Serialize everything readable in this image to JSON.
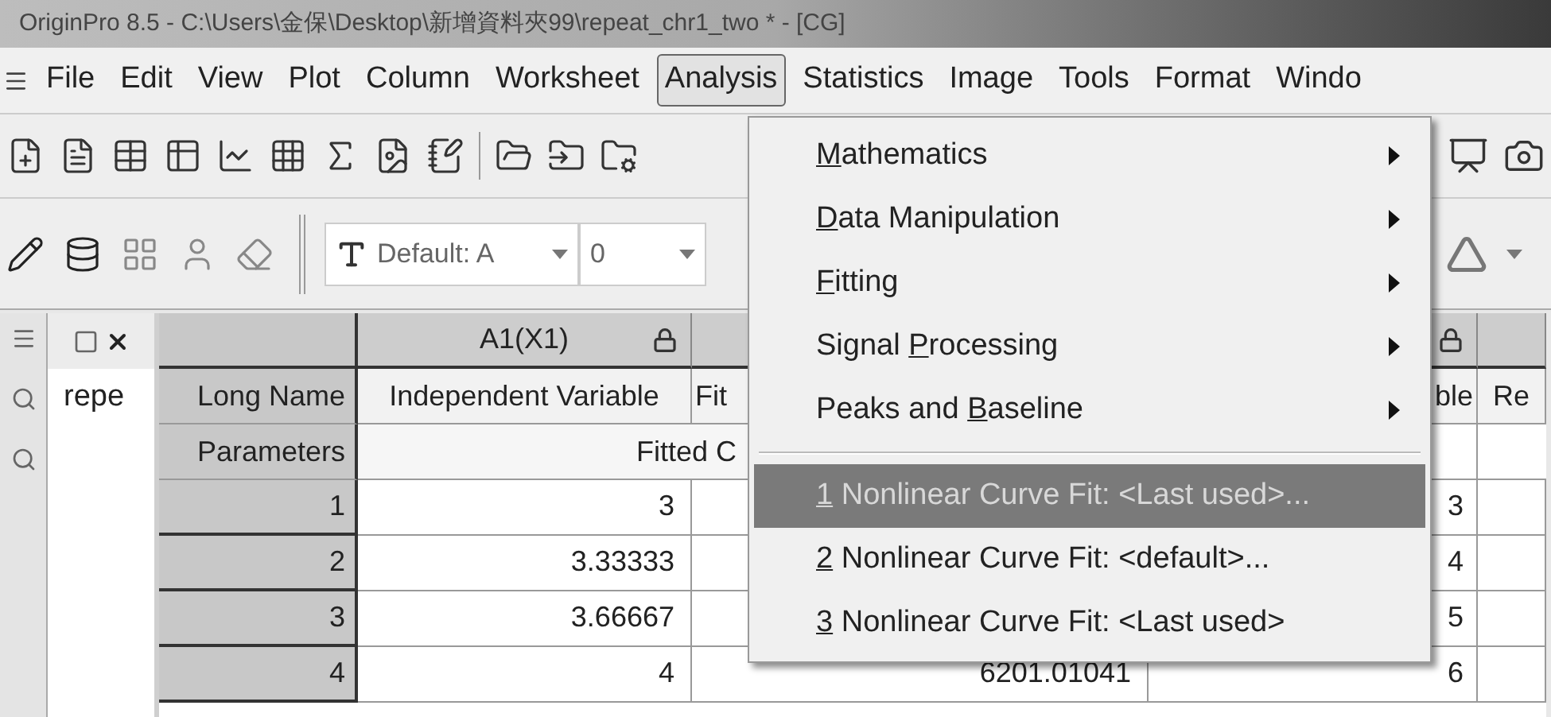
{
  "window": {
    "title": "OriginPro 8.5 - C:\\Users\\金保\\Desktop\\新增資料夾99\\repeat_chr1_two * - [CG]"
  },
  "menu_bar": [
    {
      "label": "File",
      "selected": false
    },
    {
      "label": "Edit",
      "selected": false
    },
    {
      "label": "View",
      "selected": false
    },
    {
      "label": "Plot",
      "selected": false
    },
    {
      "label": "Column",
      "selected": false
    },
    {
      "label": "Worksheet",
      "selected": false
    },
    {
      "label": "Analysis",
      "selected": true
    },
    {
      "label": "Statistics",
      "selected": false
    },
    {
      "label": "Image",
      "selected": false
    },
    {
      "label": "Tools",
      "selected": false
    },
    {
      "label": "Format",
      "selected": false
    },
    {
      "label": "Windo",
      "selected": false
    }
  ],
  "format_toolbar": {
    "font_dropdown": "Default: A",
    "size_dropdown": "0"
  },
  "project_panel": {
    "item": "repe"
  },
  "worksheet": {
    "row_labels": [
      "Long Name",
      "Parameters",
      "1",
      "2",
      "3",
      "4"
    ],
    "parameters_merged": "Fitted C",
    "columns": [
      {
        "header": "A1(X1)",
        "locked": true,
        "long_name": "Independent Variable",
        "values": [
          "3",
          "3.33333",
          "3.66667",
          "4"
        ]
      },
      {
        "long_name": "Fit",
        "last_value": "6201.01041"
      },
      {
        "locked": true,
        "long_name": "ble",
        "values": [
          "3",
          "4",
          "5",
          "6"
        ]
      },
      {
        "long_name": "Re"
      }
    ]
  },
  "analysis_menu": {
    "items": [
      {
        "kind": "submenu",
        "key": "M",
        "after": "athematics",
        "selected": false
      },
      {
        "kind": "submenu",
        "key": "D",
        "after": "ata Manipulation",
        "selected": false
      },
      {
        "kind": "submenu",
        "key": "F",
        "after": "itting",
        "selected": false
      },
      {
        "kind": "submenu",
        "before": "Signal ",
        "key": "P",
        "after": "rocessing",
        "selected": false
      },
      {
        "kind": "submenu",
        "before": "Peaks and ",
        "key": "B",
        "after": "aseline",
        "selected": false
      },
      {
        "kind": "separator"
      },
      {
        "kind": "command",
        "key": "1",
        "after": " Nonlinear Curve Fit: <Last used>...",
        "selected": true
      },
      {
        "kind": "command",
        "key": "2",
        "after": " Nonlinear Curve Fit: <default>...",
        "selected": false
      },
      {
        "kind": "command",
        "key": "3",
        "after": " Nonlinear Curve Fit: <Last used>",
        "selected": false
      }
    ]
  }
}
